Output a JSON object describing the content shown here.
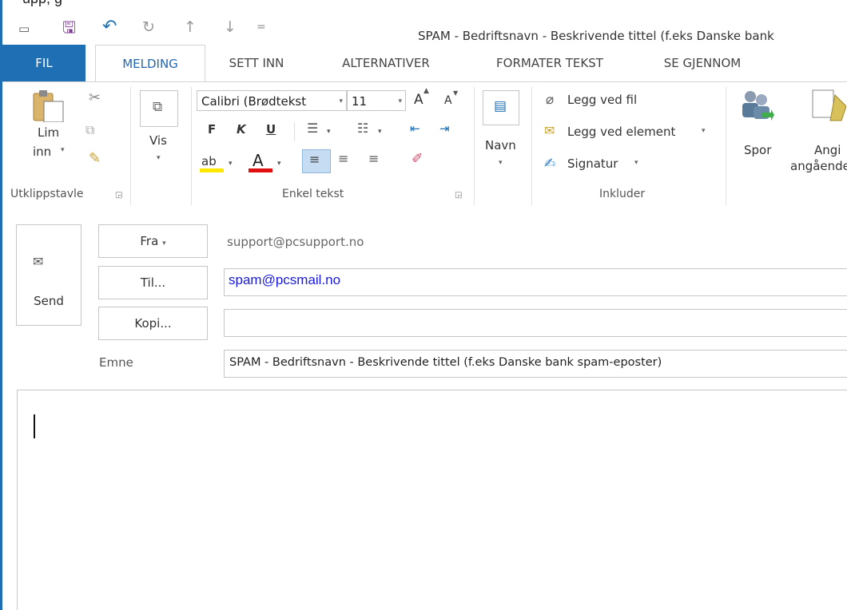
{
  "window": {
    "title": "SPAM - Bedriftsnavn - Beskrivende tittel (f.eks Danske bank",
    "top_fragment": "upp, g"
  },
  "quick_access": [
    {
      "icon": "message-icon",
      "glyph": "▭"
    },
    {
      "icon": "save-icon",
      "glyph": "🖫"
    },
    {
      "icon": "undo-icon",
      "glyph": "↶"
    },
    {
      "icon": "redo-icon",
      "glyph": "↻"
    },
    {
      "icon": "arrow-up-icon",
      "glyph": "↑"
    },
    {
      "icon": "arrow-down-icon",
      "glyph": "↓"
    },
    {
      "icon": "customize-icon",
      "glyph": "="
    }
  ],
  "tabs": {
    "file": "FIL",
    "message": "MELDING",
    "insert": "SETT INN",
    "options": "ALTERNATIVER",
    "format": "FORMATER TEKST",
    "review": "SE GJENNOM"
  },
  "ribbon": {
    "clipboard": {
      "paste_top": "Lim",
      "paste_bottom": "inn",
      "label": "Utklippstavle"
    },
    "view": {
      "label": "Vis"
    },
    "basic_text": {
      "font": "Calibri (Brødtekst",
      "size": "11",
      "bold": "F",
      "italic": "K",
      "underline": "U",
      "label": "Enkel tekst",
      "grow": "A",
      "shrink": "A"
    },
    "names": {
      "label": "Navn"
    },
    "include": {
      "attach_file": "Legg ved fil",
      "attach_item": "Legg ved element",
      "signature": "Signatur",
      "label": "Inkluder"
    },
    "tags": {
      "track": "Spor",
      "assign_top": "Angi",
      "assign_bottom": "angående"
    }
  },
  "compose": {
    "send": "Send",
    "from_button": "Fra",
    "from_value": "support@pcsupport.no",
    "to_button": "Til...",
    "to_value": "spam@pcsmail.no",
    "cc_button": "Kopi...",
    "cc_value": "",
    "subject_label": "Emne",
    "subject_value": "SPAM - Bedriftsnavn - Beskrivende tittel (f.eks Danske bank spam-eposter)"
  },
  "colors": {
    "accent": "#1f6fb5",
    "active_tab_text": "#2566b0",
    "recipient_text": "#1a1adc",
    "highlight_yellow": "#ffe800",
    "font_red": "#e01010"
  }
}
